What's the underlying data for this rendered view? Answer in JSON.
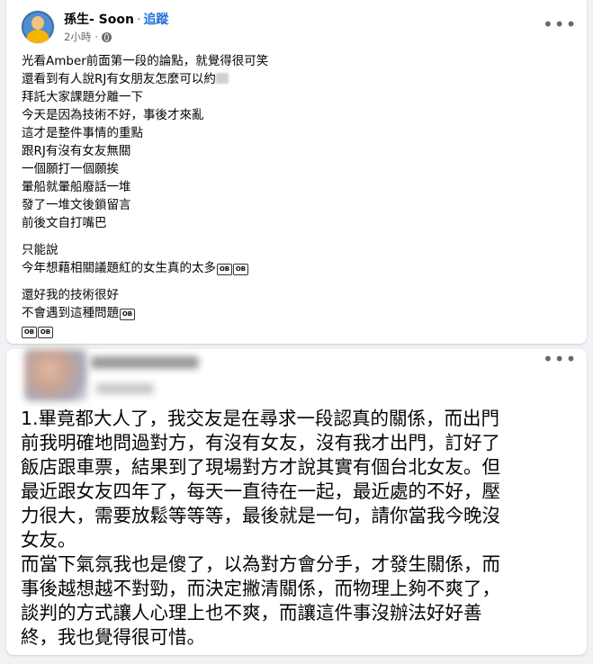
{
  "post1": {
    "author": "孫生- Soon",
    "separator": "·",
    "follow_label": "追蹤",
    "time": "2小時",
    "time_separator": "·",
    "privacy_icon": "globe-icon",
    "more_icon": "more-icon",
    "more_label": "•••",
    "lines": [
      "光看Amber前面第一段的論點，就覺得很可笑",
      "還看到有人說RJ有女朋友怎麼可以約",
      "拜託大家課題分離一下",
      "今天是因為技術不好，事後才來亂",
      "這才是整件事情的重點",
      "跟RJ有沒有女友無關",
      "一個願打一個願挨",
      "暈船就暈船廢話一堆",
      "發了一堆文後鎖留言",
      "前後文自打嘴巴"
    ],
    "lines2": [
      "只能說",
      "今年想藉相關議題紅的女生真的太多"
    ],
    "lines3": [
      "還好我的技術很好",
      "不會遇到這種問題"
    ],
    "emoji_label": "OB"
  },
  "post2": {
    "more_label": "•••",
    "lines": [
      "1.畢竟都大人了，我交友是在尋求一段認真的關係，而出門",
      "前我明確地問過對方，有沒有女友，沒有我才出門，訂好了",
      "飯店跟車票，結果到了現場對方才說其實有個台北女友。但",
      "最近跟女友四年了，每天一直待在一起，最近處的不好，壓",
      "力很大，需要放鬆等等等，最後就是一句，請你當我今晚沒",
      "女友。",
      "而當下氣氛我也是傻了，以為對方會分手，才發生關係，而",
      "事後越想越不對勁，而決定撇清關係，而物理上夠不爽了，",
      "談判的方式讓人心理上也不爽，而讓這件事沒辦法好好善",
      "終，我也覺得很可惜。"
    ]
  },
  "colors": {
    "link": "#216fdb",
    "meta": "#65676b",
    "page_bg": "#f0f2f5"
  }
}
